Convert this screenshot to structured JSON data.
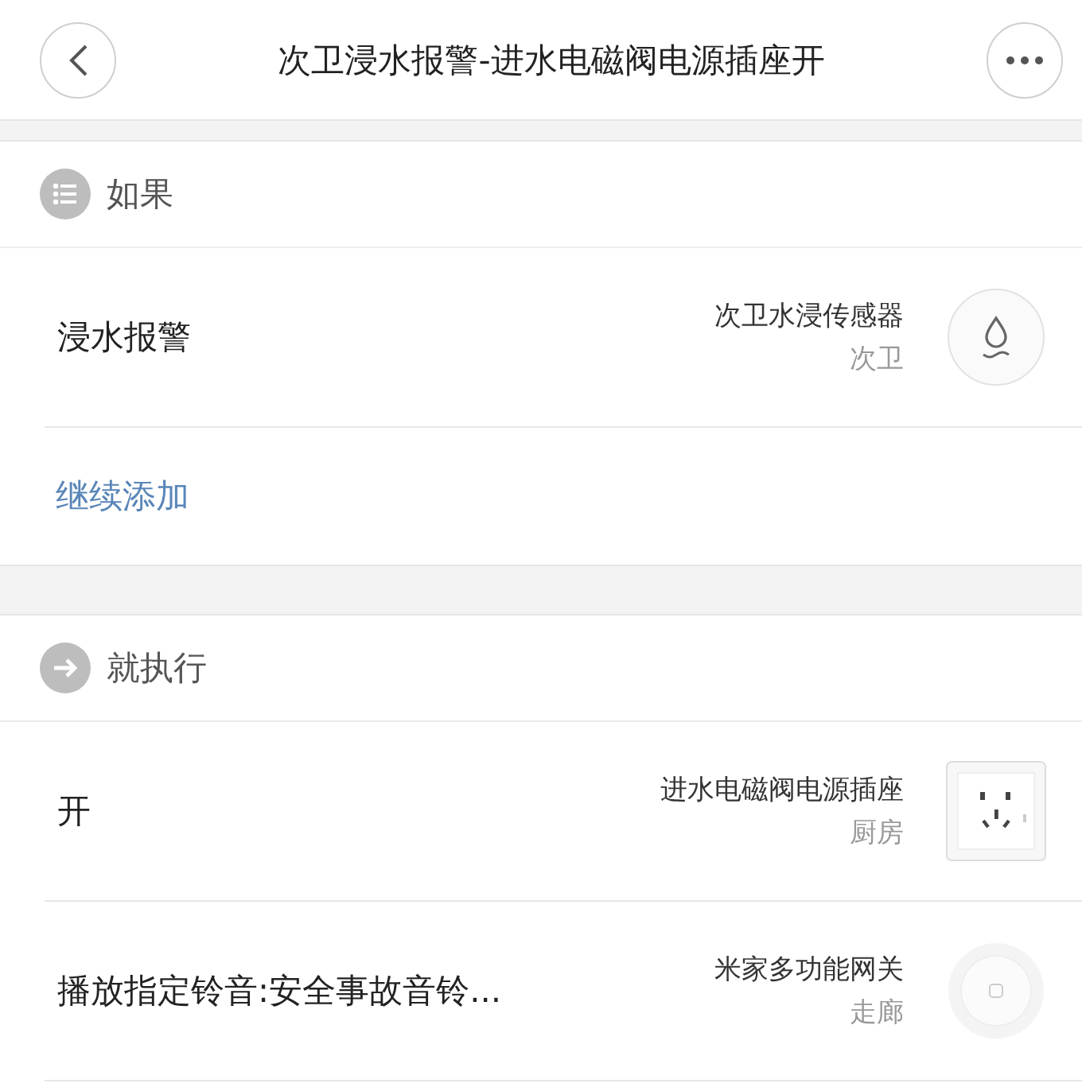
{
  "header": {
    "title": "次卫浸水报警-进水电磁阀电源插座开"
  },
  "sections": [
    {
      "kind": "condition",
      "title": "如果",
      "rows": [
        {
          "label": "浸水报警",
          "device": "次卫水浸传感器",
          "room": "次卫",
          "kind": "water"
        }
      ],
      "add_link": "继续添加"
    },
    {
      "kind": "action",
      "title": "就执行",
      "rows": [
        {
          "label": "开",
          "device": "进水电磁阀电源插座",
          "room": "厨房",
          "kind": "socket"
        },
        {
          "label": "播放指定铃音:安全事故音铃...",
          "device": "米家多功能网关",
          "room": "走廊",
          "kind": "gateway"
        }
      ]
    }
  ]
}
